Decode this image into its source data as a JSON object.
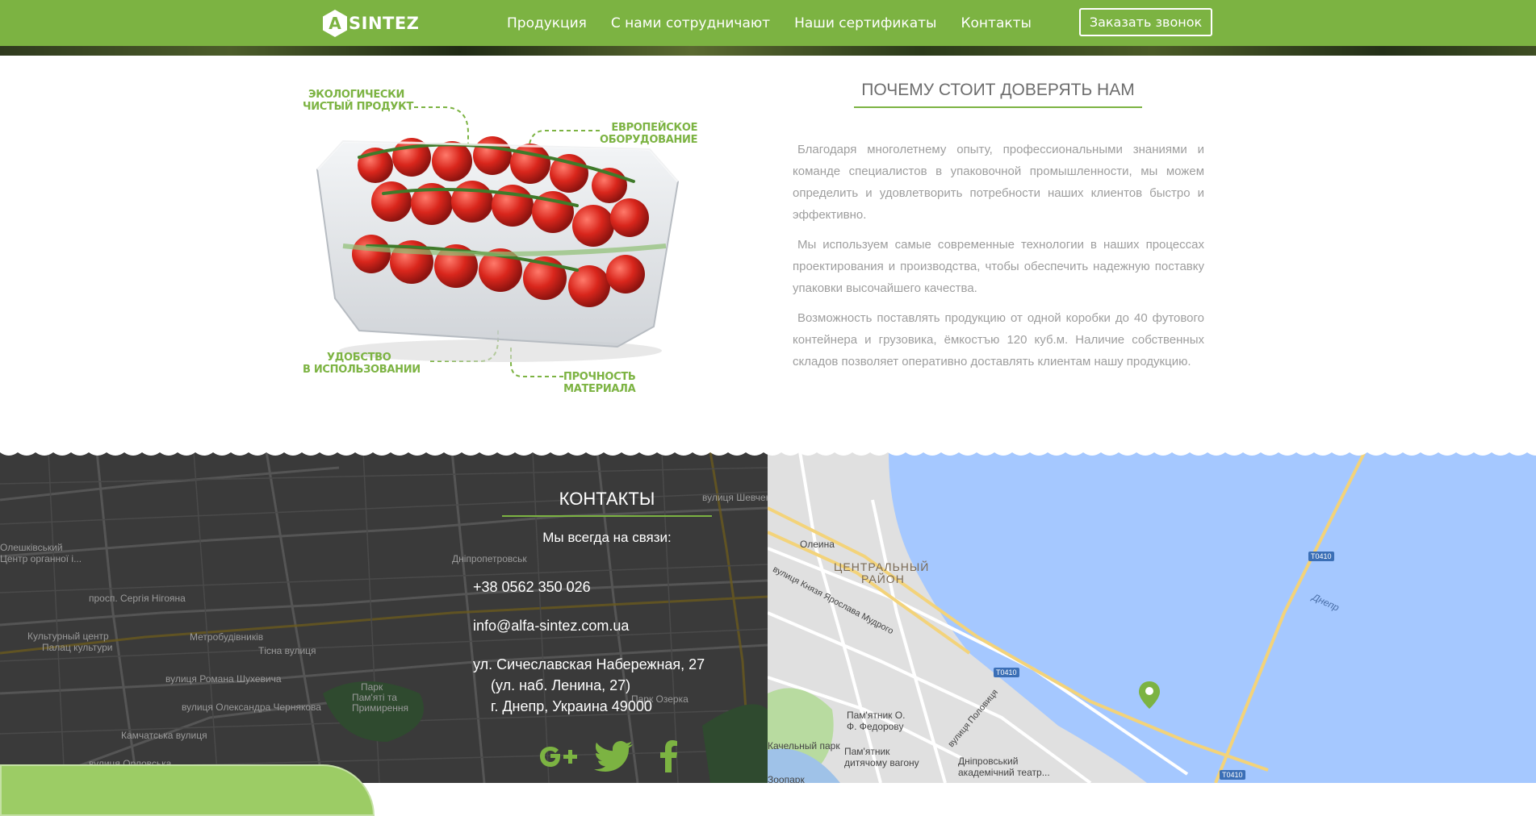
{
  "header": {
    "logo_letter": "A",
    "logo_text": "SINTEZ",
    "nav": [
      {
        "label": "Продукция"
      },
      {
        "label": "С нами сотрудничают"
      },
      {
        "label": "Наши сертификаты"
      },
      {
        "label": "Контакты"
      }
    ],
    "call_button": "Заказать звонок"
  },
  "product": {
    "callouts": {
      "eco_1": "ЭКОЛОГИЧЕСКИ",
      "eco_2": "ЧИСТЫЙ ПРОДУКТ",
      "euro_1": "ЕВРОПЕЙСКОЕ",
      "euro_2": "ОБОРУДОВАНИЕ",
      "usage_1": "УДОБСТВО",
      "usage_2": "В ИСПОЛЬЗОВАНИИ",
      "strength_1": "ПРОЧНОСТЬ",
      "strength_2": "МАТЕРИАЛА"
    }
  },
  "trust": {
    "title": "ПОЧЕМУ СТОИТ ДОВЕРЯТЬ НАМ",
    "paragraphs": [
      "Благодаря многолетнему опыту, профессиональными знаниями и команде специалистов в упаковочной промышленности, мы можем определить и удовлетворить потребности наших клиентов быстро и эффективно.",
      "Мы используем самые современные технологии в наших процессах проектирования и производства, чтобы обеспечить надежную поставку упаковки высочайшего качества.",
      "Возможность поставлять продукцию от одной коробки до 40 футового контейнера и грузовика, ёмкостъю 120 куб.м.  Наличие собственных складов позволяет оперативно доставлять клиентам нашу продукцию."
    ]
  },
  "contacts": {
    "title": "КОНТАКТЫ",
    "subtitle": "Мы всегда на связи:",
    "phone": "+38 0562 350 026",
    "email": "info@alfa-sintez.com.ua",
    "address_1": "ул. Сичеславская Набережная, 27",
    "address_2": "(ул. наб. Ленина, 27)",
    "address_3": "г. Днепр, Украина 49000",
    "social": [
      "google-plus-icon",
      "twitter-icon",
      "facebook-icon"
    ]
  },
  "map_left": {
    "labels": [
      "Культурный центр",
      "Палац культури",
      "Метробудівників",
      "Дніпропетровськ",
      "вулиця Романа Шухевича",
      "вулиця Олександра Чернякова",
      "Камчатська вулиця",
      "вулиця Орловська",
      "Тісна вулиця",
      "Парк",
      "Пам'яті та",
      "Примирення",
      "Парк Озерка",
      "просп. Сергія Нігояна",
      "вулиця Шевченка",
      "Олешківський",
      "Центр органної і..."
    ]
  },
  "map_right": {
    "labels": [
      "Олеина",
      "ЦЕНТРАЛЬНЫЙ",
      "РАЙОН",
      "вулиця Князя Ярослава Мудрого",
      "Днепр",
      "Пам'ятник О.",
      "Ф. Федорову",
      "Пам'ятник",
      "дитячому вагону",
      "Дніпровський",
      "академічний театр...",
      "Качельный парк",
      "Зоопарк",
      "вулиця Половиця"
    ],
    "road_badges": [
      "T0410",
      "T0410",
      "T0410"
    ],
    "marker": "map-pin-icon"
  },
  "colors": {
    "brand_green": "#7cb342",
    "water": "#a5c8ff",
    "land": "#e0e0e0",
    "dark_map": "#3a3a3a"
  }
}
